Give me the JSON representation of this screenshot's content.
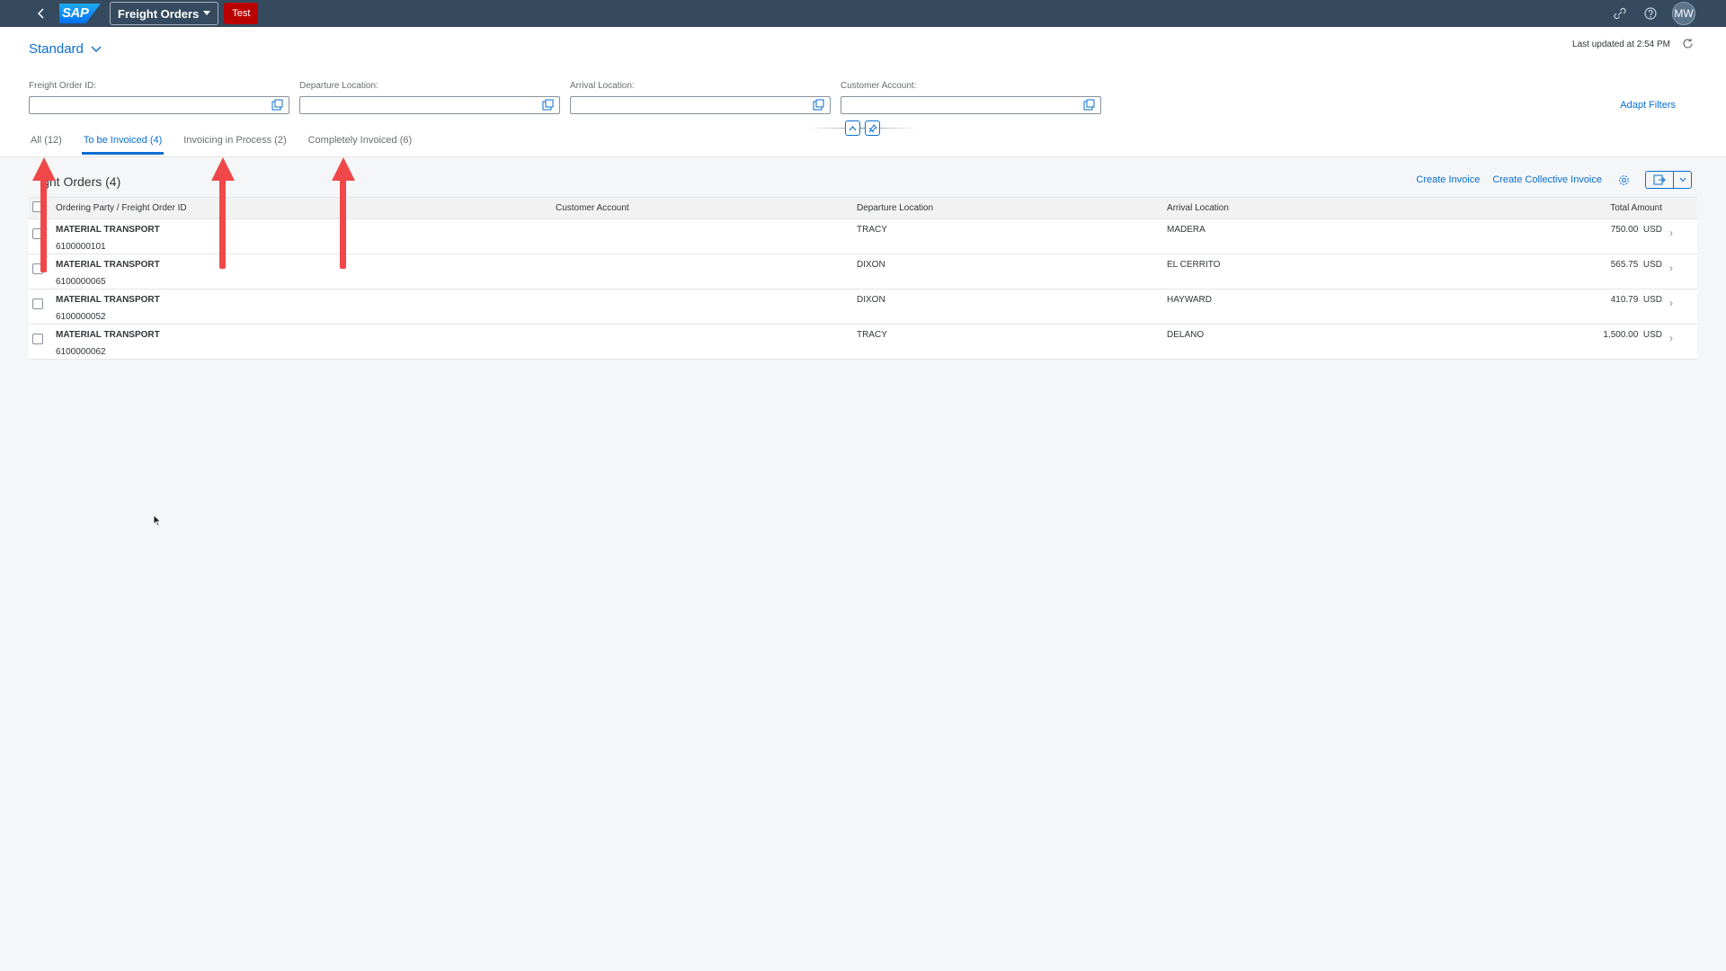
{
  "shell": {
    "logo": "SAP",
    "app_title": "Freight Orders",
    "badge": "Test",
    "avatar_initials": "MW",
    "colors": {
      "bar": "#354a5f",
      "badge": "#bb0000"
    }
  },
  "header": {
    "variant": "Standard",
    "last_updated": "Last updated at 2:54 PM",
    "adapt_filters": "Adapt Filters"
  },
  "filters": [
    {
      "label": "Freight Order ID:",
      "value": "",
      "placeholder": ""
    },
    {
      "label": "Departure Location:",
      "value": "",
      "placeholder": ""
    },
    {
      "label": "Arrival Location:",
      "value": "",
      "placeholder": ""
    },
    {
      "label": "Customer Account:",
      "value": "",
      "placeholder": ""
    }
  ],
  "tabs": [
    {
      "label": "All (12)",
      "active": false
    },
    {
      "label": "To be Invoiced (4)",
      "active": true
    },
    {
      "label": "Invoicing in Process (2)",
      "active": false
    },
    {
      "label": "Completely Invoiced (6)",
      "active": false
    }
  ],
  "table": {
    "title": "ight Orders (4)",
    "actions": {
      "create_invoice": "Create Invoice",
      "create_collective": "Create Collective Invoice"
    },
    "columns": [
      "Ordering Party / Freight Order ID",
      "Customer Account",
      "Departure Location",
      "Arrival Location",
      "Total Amount"
    ],
    "rows": [
      {
        "party": "MATERIAL TRANSPORT",
        "id": "6100000101",
        "customer": "",
        "departure": "TRACY",
        "arrival": "MADERA",
        "amount": "750.00",
        "currency": "USD"
      },
      {
        "party": "MATERIAL TRANSPORT",
        "id": "6100000065",
        "customer": "",
        "departure": "DIXON",
        "arrival": "EL CERRITO",
        "amount": "565.75",
        "currency": "USD"
      },
      {
        "party": "MATERIAL TRANSPORT",
        "id": "6100000052",
        "customer": "",
        "departure": "DIXON",
        "arrival": "HAYWARD",
        "amount": "410.79",
        "currency": "USD"
      },
      {
        "party": "MATERIAL TRANSPORT",
        "id": "6100000062",
        "customer": "",
        "departure": "TRACY",
        "arrival": "DELANO",
        "amount": "1,500.00",
        "currency": "USD"
      }
    ]
  },
  "annotation": {
    "arrow_color": "#f0484a"
  }
}
